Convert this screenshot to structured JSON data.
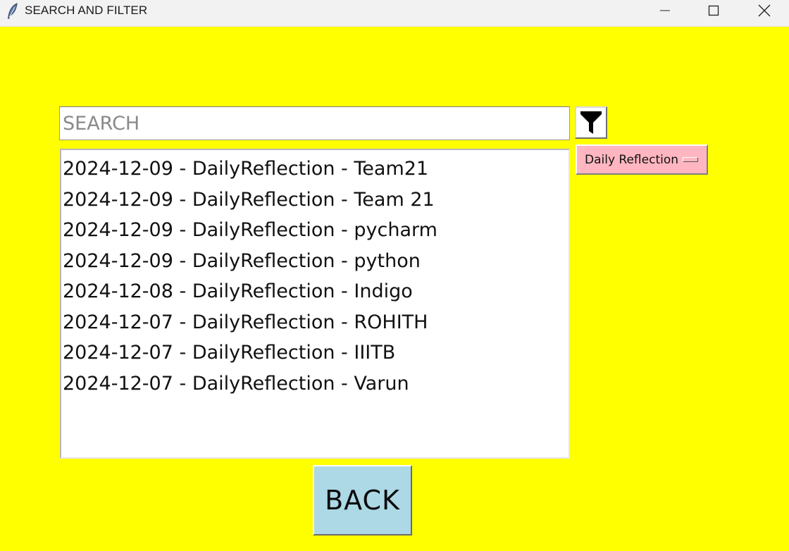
{
  "window": {
    "title": "SEARCH AND FILTER",
    "icon": "feather-icon",
    "controls": [
      "minimize-icon",
      "maximize-icon",
      "close-icon"
    ]
  },
  "colors": {
    "background": "#ffff00",
    "dropdown": "#ffb6c1",
    "back_button": "#add8e6"
  },
  "search": {
    "placeholder": "SEARCH",
    "value": ""
  },
  "filter_button": {
    "icon": "filter-funnel-icon"
  },
  "dropdown": {
    "selected": "Daily Reflection"
  },
  "results": {
    "items": [
      "2024-12-09 - DailyReflection - Team21",
      "2024-12-09 - DailyReflection - Team 21",
      "2024-12-09 - DailyReflection - pycharm",
      "2024-12-09 - DailyReflection - python",
      "2024-12-08 - DailyReflection - Indigo",
      "2024-12-07 - DailyReflection - ROHITH",
      "2024-12-07 - DailyReflection - IIITB",
      "2024-12-07 - DailyReflection - Varun"
    ]
  },
  "back_button": {
    "label": "BACK"
  }
}
